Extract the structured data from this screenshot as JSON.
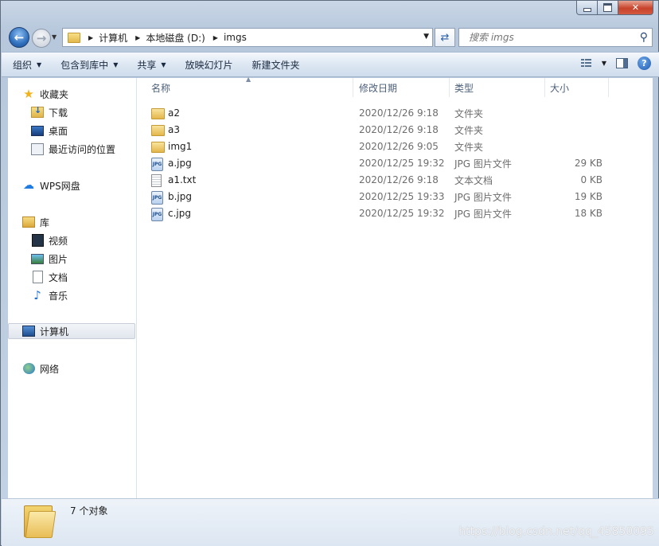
{
  "window": {
    "minimize": "",
    "maximize": "",
    "close": "✕"
  },
  "nav": {
    "back_icon": "back-arrow-icon",
    "forward_icon": "forward-arrow-icon",
    "breadcrumb": [
      "计算机",
      "本地磁盘 (D:)",
      "imgs"
    ],
    "search_placeholder": "搜索 imgs"
  },
  "toolbar": {
    "organize": "组织",
    "include_in_library": "包含到库中",
    "share": "共享",
    "slideshow": "放映幻灯片",
    "new_folder": "新建文件夹"
  },
  "sidebar": {
    "favorites": {
      "label": "收藏夹",
      "items": [
        "下载",
        "桌面",
        "最近访问的位置"
      ]
    },
    "wps": "WPS网盘",
    "libraries": {
      "label": "库",
      "items": [
        "视频",
        "图片",
        "文档",
        "音乐"
      ]
    },
    "computer": "计算机",
    "network": "网络"
  },
  "columns": {
    "name": "名称",
    "date": "修改日期",
    "type": "类型",
    "size": "大小"
  },
  "files": [
    {
      "name": "a2",
      "date": "2020/12/26 9:18",
      "type": "文件夹",
      "size": "",
      "icon": "folder"
    },
    {
      "name": "a3",
      "date": "2020/12/26 9:18",
      "type": "文件夹",
      "size": "",
      "icon": "folder"
    },
    {
      "name": "img1",
      "date": "2020/12/26 9:05",
      "type": "文件夹",
      "size": "",
      "icon": "folder"
    },
    {
      "name": "a.jpg",
      "date": "2020/12/25 19:32",
      "type": "JPG 图片文件",
      "size": "29 KB",
      "icon": "jpg"
    },
    {
      "name": "a1.txt",
      "date": "2020/12/26 9:18",
      "type": "文本文档",
      "size": "0 KB",
      "icon": "txt"
    },
    {
      "name": "b.jpg",
      "date": "2020/12/25 19:33",
      "type": "JPG 图片文件",
      "size": "19 KB",
      "icon": "jpg"
    },
    {
      "name": "c.jpg",
      "date": "2020/12/25 19:32",
      "type": "JPG 图片文件",
      "size": "18 KB",
      "icon": "jpg"
    }
  ],
  "status": {
    "count_text": "7 个对象",
    "watermark": "https://blog.csdn.net/qq_45850095"
  }
}
